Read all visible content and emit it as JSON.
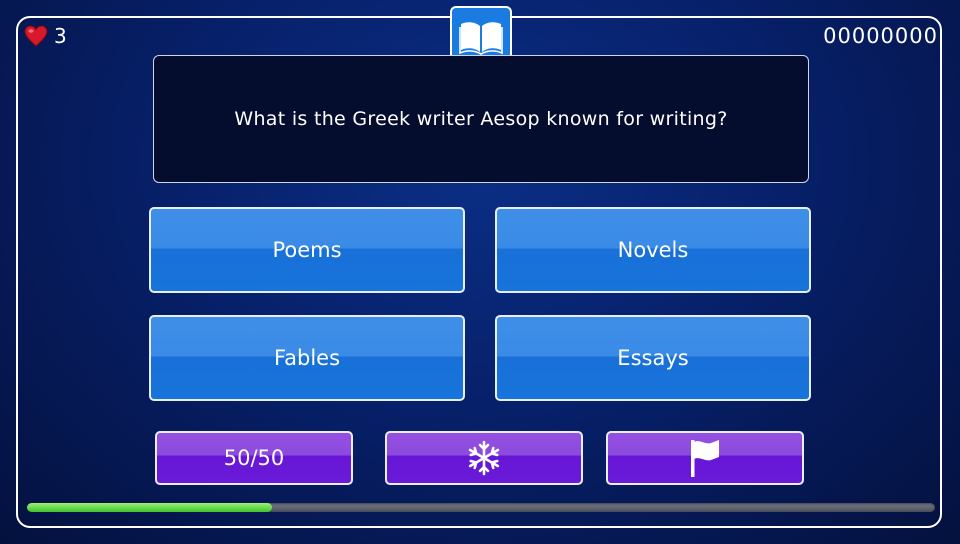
{
  "hud": {
    "lives": "3",
    "score": "00000000",
    "heart_icon": "heart-icon",
    "category_icon": "open-book-icon"
  },
  "question": {
    "text": "What is the Greek writer Aesop known for writing?"
  },
  "answers": [
    {
      "label": "Poems"
    },
    {
      "label": "Novels"
    },
    {
      "label": "Fables"
    },
    {
      "label": "Essays"
    }
  ],
  "powerups": {
    "fifty_fifty_label": "50/50",
    "freeze_icon": "snowflake-icon",
    "skip_icon": "flag-icon"
  },
  "timer": {
    "progress_fraction": 0.27
  },
  "colors": {
    "answer_button": "#1774db",
    "powerup_button": "#6a1ad8",
    "progress_fill": "#4fd034",
    "background": "#07206a"
  }
}
